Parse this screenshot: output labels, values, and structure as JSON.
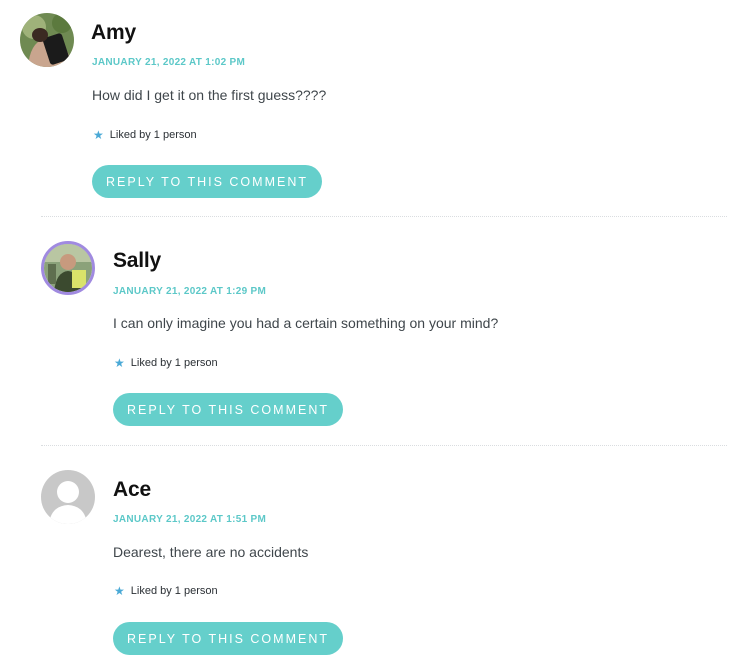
{
  "comments": [
    {
      "author": "Amy",
      "date": "JANUARY 21, 2022 AT 1:02 PM",
      "text": "How did I get it on the first guess????",
      "likes": "Liked by 1 person",
      "reply_label": "REPLY TO THIS COMMENT"
    },
    {
      "author": "Sally",
      "date": "JANUARY 21, 2022 AT 1:29 PM",
      "text": "I can only imagine you had a certain something on your mind?",
      "likes": "Liked by 1 person",
      "reply_label": "REPLY TO THIS COMMENT"
    },
    {
      "author": "Ace",
      "date": "JANUARY 21, 2022 AT 1:51 PM",
      "text": "Dearest, there are no accidents",
      "likes": "Liked by 1 person",
      "reply_label": "REPLY TO THIS COMMENT"
    }
  ],
  "colors": {
    "accent": "#65cfcb",
    "date": "#5cc8c8",
    "star": "#4aa9d6"
  },
  "icons": {
    "like": "star-icon"
  }
}
